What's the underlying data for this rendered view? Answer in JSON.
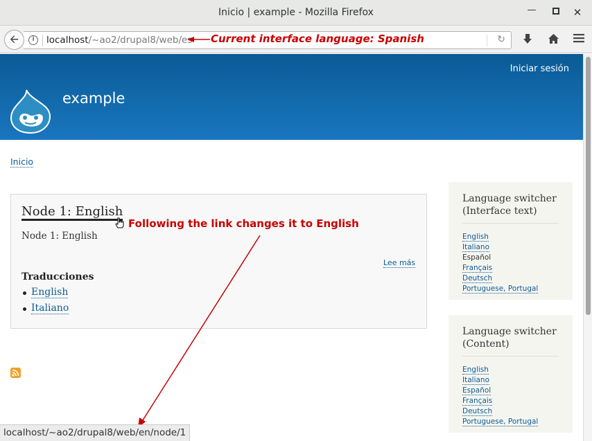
{
  "window": {
    "title": "Inicio | example - Mozilla Firefox",
    "minimize_icon": "minimize-icon",
    "maximize_icon": "maximize-icon",
    "close_icon": "close-icon"
  },
  "toolbar": {
    "back_icon": "back-arrow-icon",
    "url_host": "localhost",
    "url_path": "/~ao2/drupal8/web/es",
    "reload_icon": "reload-icon",
    "download_icon": "download-icon",
    "home_icon": "home-icon",
    "menu_icon": "hamburger-menu-icon"
  },
  "annotations": {
    "interface_language": "Current interface language: Spanish",
    "link_changes": "Following the link changes it to English",
    "color": "#c80000"
  },
  "site": {
    "login_label": "Iniciar sesión",
    "name": "example",
    "logo_icon": "drupal-drop-icon",
    "header_color": "#0a5b95"
  },
  "breadcrumb": {
    "home": "Inicio"
  },
  "node": {
    "title": "Node 1: English",
    "body": "Node 1: English",
    "read_more": "Lee más",
    "translations_heading": "Traducciones",
    "translations": [
      "English",
      "Italiano"
    ]
  },
  "feed_icon": "rss-feed-icon",
  "blocks": [
    {
      "title": "Language switcher (Interface text)",
      "items": [
        {
          "label": "English",
          "active": false
        },
        {
          "label": "Italiano",
          "active": false
        },
        {
          "label": "Español",
          "active": true
        },
        {
          "label": "Français",
          "active": false
        },
        {
          "label": "Deutsch",
          "active": false
        },
        {
          "label": "Portuguese, Portugal",
          "active": false
        }
      ]
    },
    {
      "title": "Language switcher (Content)",
      "items": [
        {
          "label": "English",
          "active": false
        },
        {
          "label": "Italiano",
          "active": false
        },
        {
          "label": "Español",
          "active": false
        },
        {
          "label": "Français",
          "active": false
        },
        {
          "label": "Deutsch",
          "active": false
        },
        {
          "label": "Portuguese, Portugal",
          "active": false
        }
      ]
    }
  ],
  "statusbar": {
    "url": "localhost/~ao2/drupal8/web/en/node/1"
  }
}
